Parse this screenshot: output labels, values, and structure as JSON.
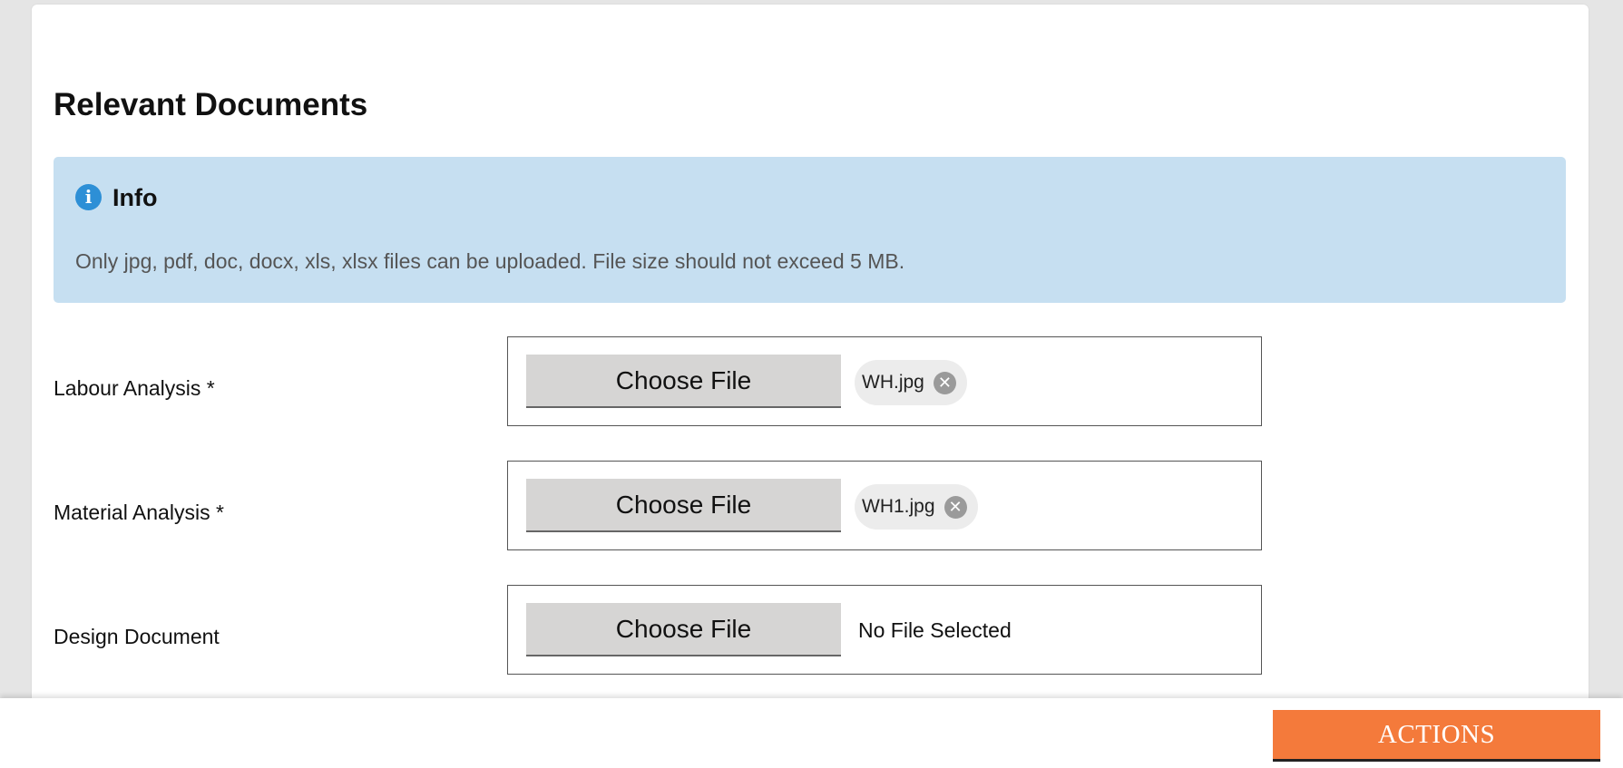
{
  "section": {
    "title": "Relevant Documents"
  },
  "info": {
    "icon": "info-icon",
    "icon_glyph": "i",
    "title": "Info",
    "message": "Only jpg, pdf, doc, docx, xls, xlsx files can be uploaded. File size should not exceed 5 MB."
  },
  "fields": {
    "labour": {
      "label": "Labour Analysis *",
      "button_label": "Choose File",
      "file_name": "WH.jpg",
      "remove_glyph": "✕"
    },
    "material": {
      "label": "Material Analysis *",
      "button_label": "Choose File",
      "file_name": "WH1.jpg",
      "remove_glyph": "✕"
    },
    "design": {
      "label": "Design Document",
      "button_label": "Choose File",
      "status": "No File Selected"
    }
  },
  "footer": {
    "actions_label": "ACTIONS"
  },
  "colors": {
    "info_background": "#c6dff1",
    "info_icon": "#2d8fd6",
    "actions_button": "#f47a3b"
  }
}
